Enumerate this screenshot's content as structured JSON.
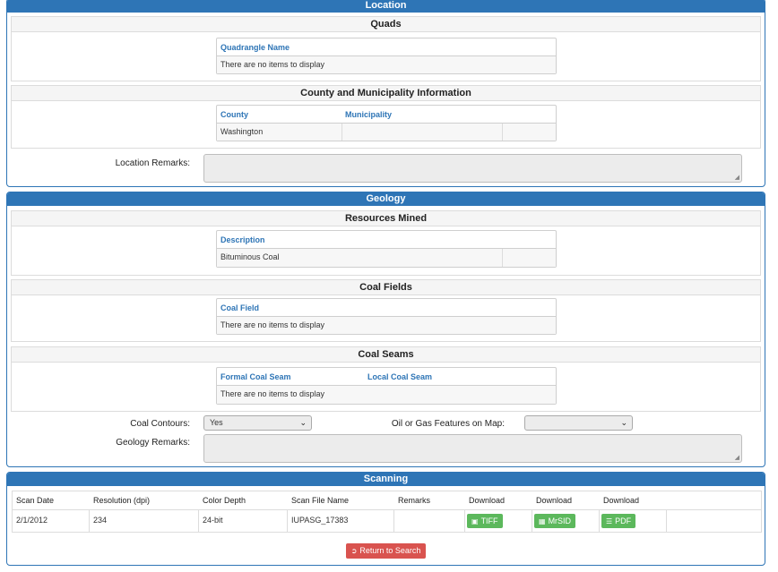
{
  "location": {
    "title": "Location",
    "quads": {
      "title": "Quads",
      "column": "Quadrangle Name",
      "empty": "There are no items to display"
    },
    "county_municipality": {
      "title": "County and Municipality Information",
      "columns": [
        "County",
        "Municipality"
      ],
      "rows": [
        [
          "Washington",
          "",
          ""
        ]
      ]
    },
    "remarks_label": "Location Remarks:"
  },
  "geology": {
    "title": "Geology",
    "resources_mined": {
      "title": "Resources Mined",
      "column": "Description",
      "rows": [
        [
          "Bituminous Coal",
          ""
        ]
      ]
    },
    "coal_fields": {
      "title": "Coal Fields",
      "column": "Coal Field",
      "empty": "There are no items to display"
    },
    "coal_seams": {
      "title": "Coal Seams",
      "columns": [
        "Formal Coal Seam",
        "Local Coal Seam"
      ],
      "empty": "There are no items to display"
    },
    "contours_label": "Coal Contours:",
    "contours_value": "Yes",
    "oil_gas_label": "Oil or Gas Features on Map:",
    "oil_gas_value": "",
    "remarks_label": "Geology Remarks:"
  },
  "scanning": {
    "title": "Scanning",
    "columns": [
      "Scan Date",
      "Resolution (dpi)",
      "Color Depth",
      "Scan File Name",
      "Remarks",
      "Download",
      "Download",
      "Download"
    ],
    "row": {
      "scan_date": "2/1/2012",
      "resolution": "234",
      "color_depth": "24-bit",
      "file_name": "IUPASG_17383",
      "remarks": "",
      "tiff": "TIFF",
      "mrsid": "MrSID",
      "pdf": "PDF"
    }
  },
  "return_label": "Return to Search",
  "colors": {
    "header_blue": "#2e75b6",
    "download_green": "#5cb85c",
    "return_red": "#d9534f"
  }
}
